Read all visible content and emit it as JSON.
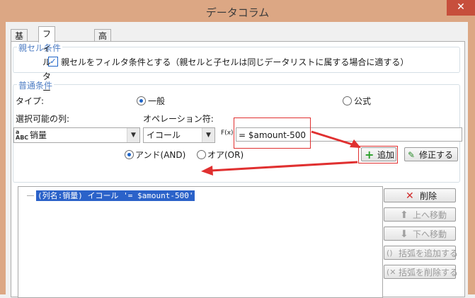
{
  "window": {
    "title": "データコラム",
    "close_glyph": "✕"
  },
  "tabs": [
    {
      "label": "基本",
      "active": false
    },
    {
      "label": "フィルター",
      "active": true
    },
    {
      "label": "高級",
      "active": false
    }
  ],
  "parent_cell": {
    "group_label": "親セル条件",
    "checkbox_checked": true,
    "checkbox_label": "親セルをフィルタ条件とする（親セルと子セルは同じデータリストに属する場合に適する）"
  },
  "normal": {
    "group_label": "普通条件",
    "type_label": "タイプ:",
    "type_options": [
      {
        "label": "一般",
        "selected": true
      },
      {
        "label": "公式",
        "selected": false
      }
    ],
    "column_label": "選択可能の列:",
    "column_value": "销量",
    "operator_label": "オペレーション符:",
    "operator_value": "イコール",
    "fx_label": "F(x)",
    "expression_value": "= $amount-500",
    "logic_options": [
      {
        "label": "アンド(AND)",
        "selected": true
      },
      {
        "label": "オア(OR)",
        "selected": false
      }
    ],
    "add_button": "追加",
    "modify_button": "修正する"
  },
  "conditions": {
    "items": [
      "(列名:销量) イコール '= $amount-500'"
    ]
  },
  "side_buttons": [
    {
      "label": "削除",
      "icon": "delete-x-icon",
      "enabled": true
    },
    {
      "label": "上へ移動",
      "icon": "up-arrow-icon",
      "enabled": false
    },
    {
      "label": "下へ移動",
      "icon": "down-arrow-icon",
      "enabled": false
    },
    {
      "label": "括弧を追加する",
      "icon": "add-bracket-icon",
      "enabled": false
    },
    {
      "label": "括弧を削除する",
      "icon": "remove-bracket-icon",
      "enabled": false
    }
  ],
  "colors": {
    "titlebar": "#dca784",
    "accent": "#1e64c8",
    "selection": "#2b62c9",
    "annotation": "#e03030"
  }
}
